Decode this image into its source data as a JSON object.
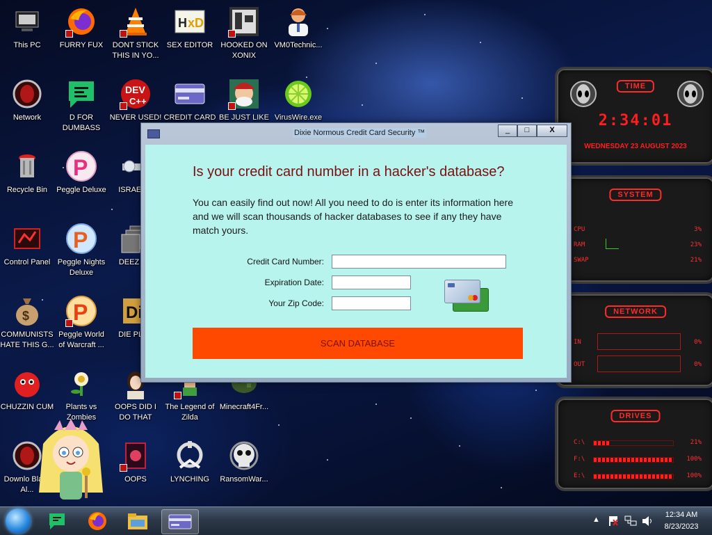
{
  "desktop": {
    "icons": [
      {
        "label": "This PC",
        "icon": "computer-icon"
      },
      {
        "label": "FURRY FUX",
        "icon": "firefox-icon"
      },
      {
        "label": "DONT STICK THIS IN YO...",
        "icon": "vlc-cone-icon"
      },
      {
        "label": "SEX EDITOR",
        "icon": "hxd-editor-icon"
      },
      {
        "label": "HOOKED ON XONIX",
        "icon": "xonix-game-icon"
      },
      {
        "label": "VM0Technic...",
        "icon": "doctor-icon"
      },
      {
        "label": "Network",
        "icon": "alien-network-icon"
      },
      {
        "label": "D FOR DUMBASS",
        "icon": "green-chat-icon"
      },
      {
        "label": "NEVER USED!",
        "icon": "devcpp-icon"
      },
      {
        "label": "CREDIT CARD CHECKER",
        "icon": "credit-card-icon"
      },
      {
        "label": "BE JUST LIKE THE DUDE!",
        "icon": "dude-icon"
      },
      {
        "label": "VirusWire.exe",
        "icon": "lime-icon"
      },
      {
        "label": "Recycle Bin",
        "icon": "recycle-bin-icon"
      },
      {
        "label": "Peggle Deluxe",
        "icon": "peggle-icon"
      },
      {
        "label": "ISRAELIS",
        "icon": "pipe-icon"
      },
      {
        "label": "Control Panel",
        "icon": "control-panel-icon"
      },
      {
        "label": "Peggle Nights Deluxe",
        "icon": "peggle-nights-icon"
      },
      {
        "label": "DEEZ NU",
        "icon": "windows-stack-icon"
      },
      {
        "label": "COMMUNISTS HATE THIS G...",
        "icon": "money-bag-icon"
      },
      {
        "label": "Peggle World of Warcraft ...",
        "icon": "peggle-wow-icon"
      },
      {
        "label": "DIE PLEA",
        "icon": "die-icon"
      },
      {
        "label": "CHUZZIN CUM",
        "icon": "chuzzle-icon"
      },
      {
        "label": "Plants vs Zombies",
        "icon": "plants-vs-zombies-icon"
      },
      {
        "label": "OOPS DID I DO THAT",
        "icon": "portrait-icon"
      },
      {
        "label": "The Legend of Zilda",
        "icon": "zelda-icon"
      },
      {
        "label": "Minecraft4Fr...",
        "icon": "minecraft-icon"
      },
      {
        "label": "Downlo Black Al...",
        "icon": "alien-download-icon"
      },
      {
        "label": "OOPS",
        "icon": "oops-box-icon"
      },
      {
        "label": "LYNCHING",
        "icon": "noose-icon"
      },
      {
        "label": "RansomWar...",
        "icon": "skull-icon"
      }
    ]
  },
  "gadget": {
    "time_title": "TIME",
    "time": "2:34:01",
    "date": "WEDNESDAY 23 AUGUST 2023",
    "system_title": "SYSTEM",
    "system_rows": [
      {
        "label": "CPU",
        "value": "3%"
      },
      {
        "label": "RAM",
        "value": "23%"
      },
      {
        "label": "SWAP",
        "value": "21%"
      }
    ],
    "network_title": "NETWORK",
    "network_rows": [
      {
        "label": "IN",
        "value": "0%"
      },
      {
        "label": "OUT",
        "value": "0%"
      }
    ],
    "drives_title": "DRIVES",
    "drives_rows": [
      {
        "label": "C:\\",
        "value": "21%",
        "fill": 0.21
      },
      {
        "label": "F:\\",
        "value": "100%",
        "fill": 1.0
      },
      {
        "label": "E:\\",
        "value": "100%",
        "fill": 1.0
      }
    ]
  },
  "window": {
    "title": "Dixie Normous Credit Card Security ™",
    "minimize": "_",
    "maximize": "□",
    "close": "X",
    "heading": "Is your credit card number in a hacker's database?",
    "intro": "You can easily find out now! All you need to do is enter its information here and we will scan thousands of hacker databases to see if any they have match yours.",
    "fields": {
      "card_label": "Credit Card Number:",
      "card_value": "",
      "exp_label": "Expiration Date:",
      "exp_value": "",
      "zip_label": "Your Zip Code:",
      "zip_value": ""
    },
    "scan_button": "SCAN DATABASE",
    "colors": {
      "accent": "#ff4800",
      "heading": "#7a1010",
      "client_bg": "#b8f4ee"
    }
  },
  "taskbar": {
    "items": [
      "green-chat-icon",
      "firefox-icon",
      "file-explorer-icon",
      "credit-card-icon"
    ],
    "time": "12:34 AM",
    "date": "8/23/2023"
  }
}
